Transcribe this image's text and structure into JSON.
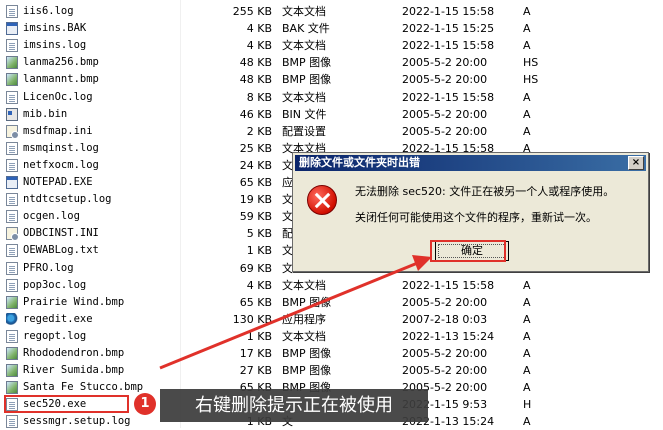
{
  "colors": {
    "accent": "#e0312a",
    "titlebar_start": "#0a246a",
    "titlebar_end": "#3a6ea5",
    "dialog_bg": "#ece9d8"
  },
  "files": [
    {
      "name": "iis6.log",
      "size": "255 KB",
      "type": "文本文档",
      "date": "2022-1-15 15:58",
      "attr": "A",
      "icon": "doc-icon"
    },
    {
      "name": "imsins.BAK",
      "size": "4 KB",
      "type": "BAK 文件",
      "date": "2022-1-15 15:25",
      "attr": "A",
      "icon": "exe-icon"
    },
    {
      "name": "imsins.log",
      "size": "4 KB",
      "type": "文本文档",
      "date": "2022-1-15 15:58",
      "attr": "A",
      "icon": "doc-icon"
    },
    {
      "name": "lanma256.bmp",
      "size": "48 KB",
      "type": "BMP 图像",
      "date": "2005-5-2 20:00",
      "attr": "HS",
      "icon": "bmp-icon"
    },
    {
      "name": "lanmannt.bmp",
      "size": "48 KB",
      "type": "BMP 图像",
      "date": "2005-5-2 20:00",
      "attr": "HS",
      "icon": "bmp-icon"
    },
    {
      "name": "LicenOc.log",
      "size": "8 KB",
      "type": "文本文档",
      "date": "2022-1-15 15:58",
      "attr": "A",
      "icon": "doc-icon"
    },
    {
      "name": "mib.bin",
      "size": "46 KB",
      "type": "BIN 文件",
      "date": "2005-5-2 20:00",
      "attr": "A",
      "icon": "bin-icon"
    },
    {
      "name": "msdfmap.ini",
      "size": "2 KB",
      "type": "配置设置",
      "date": "2005-5-2 20:00",
      "attr": "A",
      "icon": "ini-icon"
    },
    {
      "name": "msmqinst.log",
      "size": "25 KB",
      "type": "文本文档",
      "date": "2022-1-15 15:58",
      "attr": "A",
      "icon": "doc-icon"
    },
    {
      "name": "netfxocm.log",
      "size": "24 KB",
      "type": "文",
      "date": "",
      "attr": "",
      "icon": "doc-icon"
    },
    {
      "name": "NOTEPAD.EXE",
      "size": "65 KB",
      "type": "应",
      "date": "",
      "attr": "",
      "icon": "exe-icon"
    },
    {
      "name": "ntdtcsetup.log",
      "size": "19 KB",
      "type": "文",
      "date": "",
      "attr": "",
      "icon": "doc-icon"
    },
    {
      "name": "ocgen.log",
      "size": "59 KB",
      "type": "文",
      "date": "",
      "attr": "",
      "icon": "doc-icon"
    },
    {
      "name": "ODBCINST.INI",
      "size": "5 KB",
      "type": "配",
      "date": "",
      "attr": "",
      "icon": "ini-icon"
    },
    {
      "name": "OEWABLog.txt",
      "size": "1 KB",
      "type": "文",
      "date": "",
      "attr": "",
      "icon": "doc-icon"
    },
    {
      "name": "PFRO.log",
      "size": "69 KB",
      "type": "文",
      "date": "",
      "attr": "",
      "icon": "doc-icon"
    },
    {
      "name": "pop3oc.log",
      "size": "4 KB",
      "type": "文本文档",
      "date": "2022-1-15 15:58",
      "attr": "A",
      "icon": "doc-icon"
    },
    {
      "name": "Prairie Wind.bmp",
      "size": "65 KB",
      "type": "BMP 图像",
      "date": "2005-5-2 20:00",
      "attr": "A",
      "icon": "bmp-icon"
    },
    {
      "name": "regedit.exe",
      "size": "130 KB",
      "type": "应用程序",
      "date": "2007-2-18 0:03",
      "attr": "A",
      "icon": "reg-icon"
    },
    {
      "name": "regopt.log",
      "size": "1 KB",
      "type": "文本文档",
      "date": "2022-1-13 15:24",
      "attr": "A",
      "icon": "doc-icon"
    },
    {
      "name": "Rhododendron.bmp",
      "size": "17 KB",
      "type": "BMP 图像",
      "date": "2005-5-2 20:00",
      "attr": "A",
      "icon": "bmp-icon"
    },
    {
      "name": "River Sumida.bmp",
      "size": "27 KB",
      "type": "BMP 图像",
      "date": "2005-5-2 20:00",
      "attr": "A",
      "icon": "bmp-icon"
    },
    {
      "name": "Santa Fe Stucco.bmp",
      "size": "65 KB",
      "type": "BMP 图像",
      "date": "2005-5-2 20:00",
      "attr": "A",
      "icon": "bmp-icon"
    },
    {
      "name": "sec520.exe",
      "size": "",
      "type": "",
      "date": "2022-1-15 9:53",
      "attr": "H",
      "icon": "doc-icon"
    },
    {
      "name": "sessmgr.setup.log",
      "size": "1 KB",
      "type": "文",
      "date": "2022-1-13 15:24",
      "attr": "A",
      "icon": "doc-icon"
    }
  ],
  "dialog": {
    "title": "删除文件或文件夹时出错",
    "close": "×",
    "message_1": "无法删除 sec520: 文件正在被另一个人或程序使用。",
    "message_2": "关闭任何可能使用这个文件的程序，重新试一次。",
    "ok_label": "确定",
    "icon": "error-icon"
  },
  "annotation": {
    "step_number": "1",
    "caption": "右键删除提示正在被使用"
  }
}
